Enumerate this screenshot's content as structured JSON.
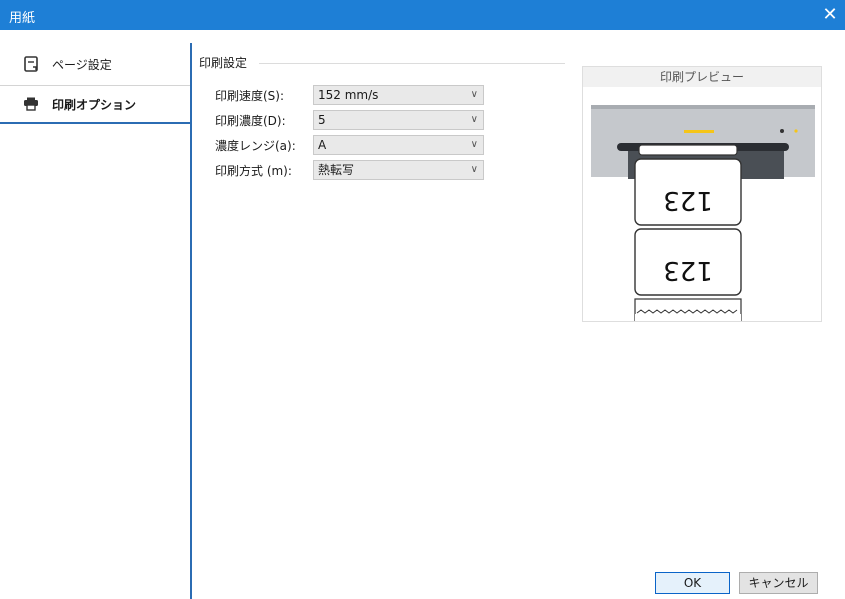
{
  "window": {
    "title": "用紙",
    "close_glyph": "✕"
  },
  "sidebar": {
    "items": [
      {
        "label": "ページ設定",
        "icon": "page-setup-icon"
      },
      {
        "label": "印刷オプション",
        "icon": "printer-icon"
      }
    ]
  },
  "print_settings": {
    "section_title": "印刷設定",
    "rows": [
      {
        "label": "印刷速度(S):",
        "value": "152 mm/s"
      },
      {
        "label": "印刷濃度(D):",
        "value": "5"
      },
      {
        "label": "濃度レンジ(a):",
        "value": "A"
      },
      {
        "label": "印刷方式 (m):",
        "value": "熱転写"
      }
    ]
  },
  "preview": {
    "title": "印刷プレビュー",
    "label_text": "123"
  },
  "buttons": {
    "ok": "OK",
    "cancel": "キャンセル"
  },
  "colors": {
    "titlebar": "#1e7fd6",
    "accent": "#2b6cb3"
  }
}
